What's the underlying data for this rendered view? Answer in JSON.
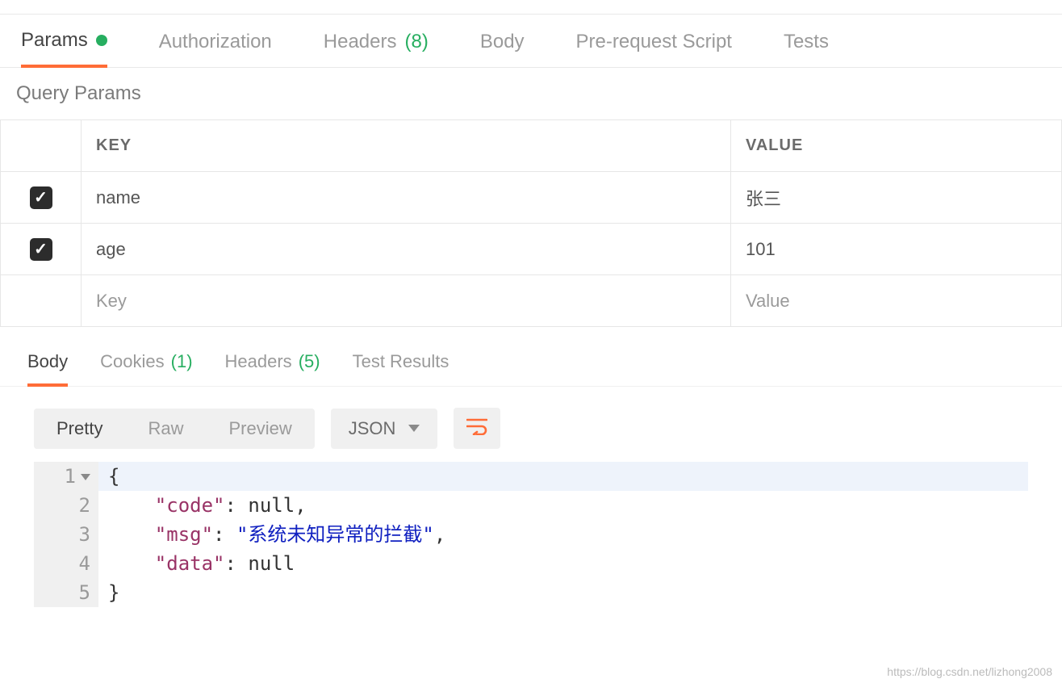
{
  "req_tabs": {
    "params": "Params",
    "authorization": "Authorization",
    "headers": "Headers",
    "headers_count": "(8)",
    "body": "Body",
    "prerequest": "Pre-request Script",
    "tests": "Tests"
  },
  "query_params": {
    "title": "Query Params",
    "columns": {
      "key": "KEY",
      "value": "VALUE"
    },
    "rows": [
      {
        "checked": true,
        "key": "name",
        "value": "张三"
      },
      {
        "checked": true,
        "key": "age",
        "value": "101"
      }
    ],
    "placeholder": {
      "key": "Key",
      "value": "Value"
    }
  },
  "resp_tabs": {
    "body": "Body",
    "cookies": "Cookies",
    "cookies_count": "(1)",
    "headers": "Headers",
    "headers_count": "(5)",
    "test_results": "Test Results"
  },
  "resp_toolbar": {
    "pretty": "Pretty",
    "raw": "Raw",
    "preview": "Preview",
    "format": "JSON"
  },
  "response_json": {
    "lines": [
      {
        "n": "1",
        "arrow": true,
        "hl": true,
        "raw": "{"
      },
      {
        "n": "2",
        "indent": "    ",
        "key": "\"code\"",
        "sep": ": ",
        "val": "null",
        "valtype": "null",
        "trail": ","
      },
      {
        "n": "3",
        "indent": "    ",
        "key": "\"msg\"",
        "sep": ": ",
        "val": "\"系统未知异常的拦截\"",
        "valtype": "str",
        "trail": ","
      },
      {
        "n": "4",
        "indent": "    ",
        "key": "\"data\"",
        "sep": ": ",
        "val": "null",
        "valtype": "null",
        "trail": ""
      },
      {
        "n": "5",
        "raw": "}"
      }
    ]
  },
  "watermark": "https://blog.csdn.net/lizhong2008"
}
